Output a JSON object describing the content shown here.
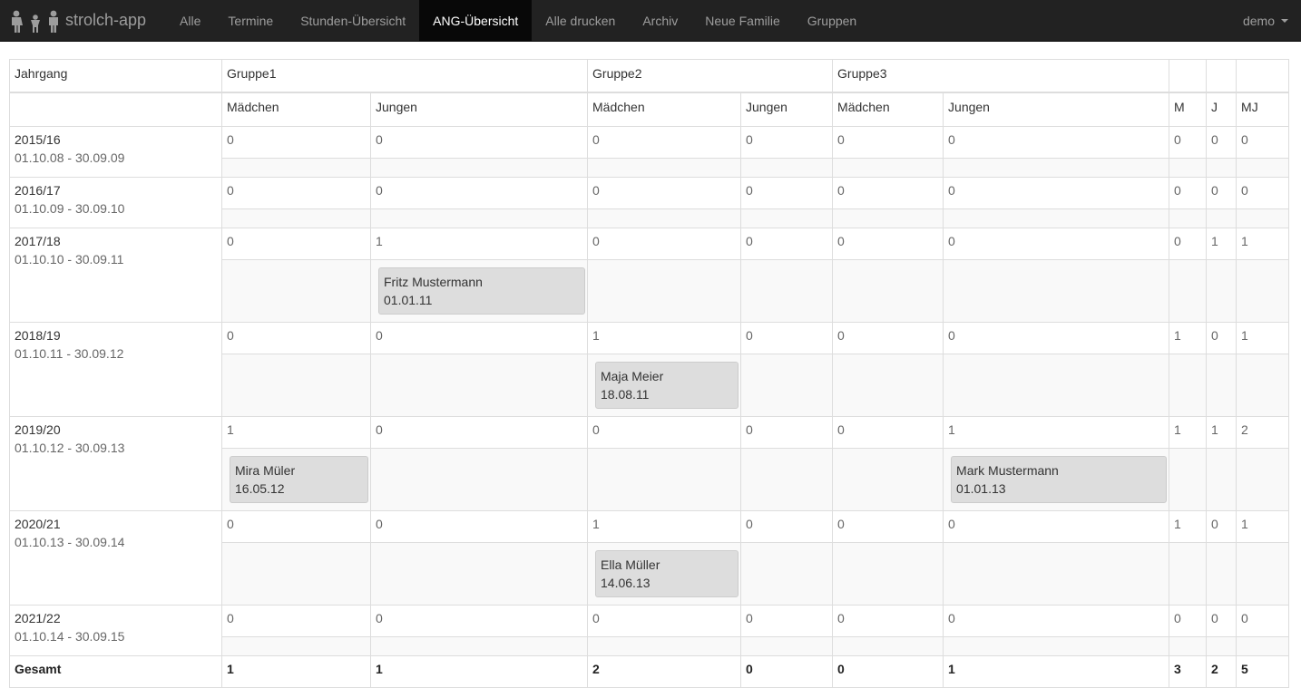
{
  "nav": {
    "brand": "strolch-app",
    "items": [
      {
        "label": "Alle",
        "active": false
      },
      {
        "label": "Termine",
        "active": false
      },
      {
        "label": "Stunden-Übersicht",
        "active": false
      },
      {
        "label": "ANG-Übersicht",
        "active": true
      },
      {
        "label": "Alle drucken",
        "active": false
      },
      {
        "label": "Archiv",
        "active": false
      },
      {
        "label": "Neue Familie",
        "active": false
      },
      {
        "label": "Gruppen",
        "active": false
      }
    ],
    "user": "demo"
  },
  "table": {
    "header": {
      "jahrgang": "Jahrgang",
      "groups": [
        "Gruppe1",
        "Gruppe2",
        "Gruppe3"
      ],
      "maedchen": "Mädchen",
      "jungen": "Jungen",
      "m": "M",
      "j": "J",
      "mj": "MJ"
    },
    "rows": [
      {
        "year": "2015/16",
        "range": "01.10.08 - 30.09.09",
        "counts": [
          "0",
          "0",
          "0",
          "0",
          "0",
          "0"
        ],
        "m": "0",
        "j": "0",
        "mj": "0",
        "cards": [
          [],
          [],
          [],
          [],
          [],
          []
        ]
      },
      {
        "year": "2016/17",
        "range": "01.10.09 - 30.09.10",
        "counts": [
          "0",
          "0",
          "0",
          "0",
          "0",
          "0"
        ],
        "m": "0",
        "j": "0",
        "mj": "0",
        "cards": [
          [],
          [],
          [],
          [],
          [],
          []
        ]
      },
      {
        "year": "2017/18",
        "range": "01.10.10 - 30.09.11",
        "counts": [
          "0",
          "1",
          "0",
          "0",
          "0",
          "0"
        ],
        "m": "0",
        "j": "1",
        "mj": "1",
        "cards": [
          [],
          [
            {
              "name": "Fritz Mustermann",
              "date": "01.01.11"
            }
          ],
          [],
          [],
          [],
          []
        ]
      },
      {
        "year": "2018/19",
        "range": "01.10.11 - 30.09.12",
        "counts": [
          "0",
          "0",
          "1",
          "0",
          "0",
          "0"
        ],
        "m": "1",
        "j": "0",
        "mj": "1",
        "cards": [
          [],
          [],
          [
            {
              "name": "Maja Meier",
              "date": "18.08.11"
            }
          ],
          [],
          [],
          []
        ]
      },
      {
        "year": "2019/20",
        "range": "01.10.12 - 30.09.13",
        "counts": [
          "1",
          "0",
          "0",
          "0",
          "0",
          "1"
        ],
        "m": "1",
        "j": "1",
        "mj": "2",
        "cards": [
          [
            {
              "name": "Mira Müler",
              "date": "16.05.12"
            }
          ],
          [],
          [],
          [],
          [],
          [
            {
              "name": "Mark Mustermann",
              "date": "01.01.13"
            }
          ]
        ]
      },
      {
        "year": "2020/21",
        "range": "01.10.13 - 30.09.14",
        "counts": [
          "0",
          "0",
          "1",
          "0",
          "0",
          "0"
        ],
        "m": "1",
        "j": "0",
        "mj": "1",
        "cards": [
          [],
          [],
          [
            {
              "name": "Ella Müller",
              "date": "14.06.13"
            }
          ],
          [],
          [],
          []
        ]
      },
      {
        "year": "2021/22",
        "range": "01.10.14 - 30.09.15",
        "counts": [
          "0",
          "0",
          "0",
          "0",
          "0",
          "0"
        ],
        "m": "0",
        "j": "0",
        "mj": "0",
        "cards": [
          [],
          [],
          [],
          [],
          [],
          []
        ]
      }
    ],
    "total": {
      "label": "Gesamt",
      "counts": [
        "1",
        "1",
        "2",
        "0",
        "0",
        "1"
      ],
      "m": "3",
      "j": "2",
      "mj": "5"
    }
  }
}
